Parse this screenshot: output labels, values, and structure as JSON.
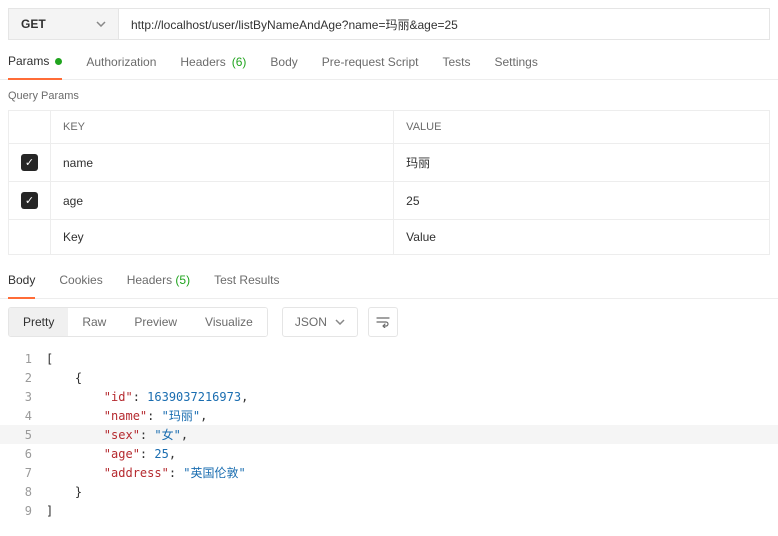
{
  "request": {
    "method": "GET",
    "url": "http://localhost/user/listByNameAndAge?name=玛丽&age=25"
  },
  "tabs": {
    "params": "Params",
    "authorization": "Authorization",
    "headers": "Headers",
    "headers_count": "(6)",
    "body": "Body",
    "prerequest": "Pre-request Script",
    "tests": "Tests",
    "settings": "Settings"
  },
  "query_params": {
    "label": "Query Params",
    "columns": {
      "key": "KEY",
      "value": "VALUE"
    },
    "rows": [
      {
        "key": "name",
        "value": "玛丽",
        "checked": true
      },
      {
        "key": "age",
        "value": "25",
        "checked": true
      }
    ],
    "placeholder_key": "Key",
    "placeholder_value": "Value"
  },
  "response": {
    "tabs": {
      "body": "Body",
      "cookies": "Cookies",
      "headers": "Headers",
      "headers_count": "(5)",
      "test_results": "Test Results"
    },
    "views": {
      "pretty": "Pretty",
      "raw": "Raw",
      "preview": "Preview",
      "visualize": "Visualize"
    },
    "format": "JSON",
    "highlighted_line": 5,
    "lines": [
      {
        "n": 1,
        "indent": 0,
        "tokens": [
          [
            "punc",
            "["
          ]
        ]
      },
      {
        "n": 2,
        "indent": 1,
        "tokens": [
          [
            "punc",
            "{"
          ]
        ]
      },
      {
        "n": 3,
        "indent": 2,
        "tokens": [
          [
            "key",
            "\"id\""
          ],
          [
            "punc",
            ": "
          ],
          [
            "num",
            "1639037216973"
          ],
          [
            "punc",
            ","
          ]
        ]
      },
      {
        "n": 4,
        "indent": 2,
        "tokens": [
          [
            "key",
            "\"name\""
          ],
          [
            "punc",
            ": "
          ],
          [
            "str",
            "\"玛丽\""
          ],
          [
            "punc",
            ","
          ]
        ]
      },
      {
        "n": 5,
        "indent": 2,
        "tokens": [
          [
            "key",
            "\"sex\""
          ],
          [
            "punc",
            ": "
          ],
          [
            "str",
            "\"女\""
          ],
          [
            "punc",
            ","
          ]
        ]
      },
      {
        "n": 6,
        "indent": 2,
        "tokens": [
          [
            "key",
            "\"age\""
          ],
          [
            "punc",
            ": "
          ],
          [
            "num",
            "25"
          ],
          [
            "punc",
            ","
          ]
        ]
      },
      {
        "n": 7,
        "indent": 2,
        "tokens": [
          [
            "key",
            "\"address\""
          ],
          [
            "punc",
            ": "
          ],
          [
            "str",
            "\"英国伦敦\""
          ]
        ]
      },
      {
        "n": 8,
        "indent": 1,
        "tokens": [
          [
            "punc",
            "}"
          ]
        ]
      },
      {
        "n": 9,
        "indent": 0,
        "tokens": [
          [
            "punc",
            "]"
          ]
        ]
      }
    ]
  }
}
